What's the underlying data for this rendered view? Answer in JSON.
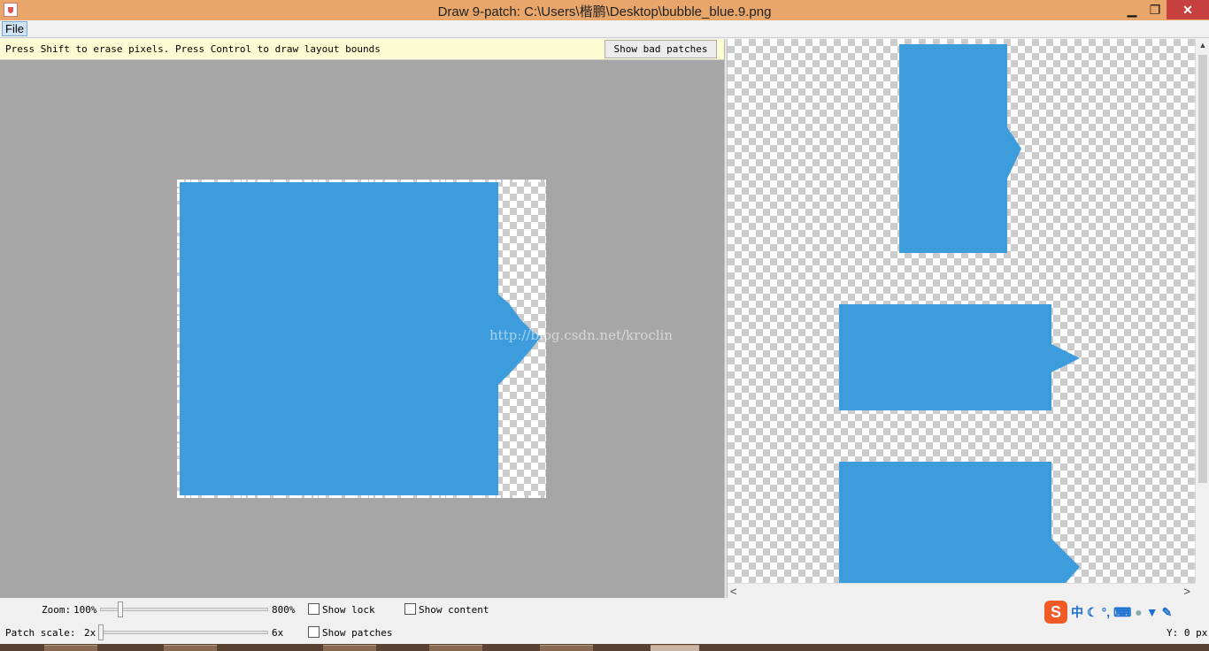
{
  "window": {
    "title": "Draw 9-patch: C:\\Users\\楷鹏\\Desktop\\bubble_blue.9.png",
    "minimize": "▁",
    "maximize": "❐",
    "close": "✕"
  },
  "menu": {
    "file": "File"
  },
  "hint": {
    "text": "Press Shift to erase pixels. Press Control to draw layout bounds",
    "show_bad_patches": "Show bad patches"
  },
  "watermark": "http://blog.csdn.net/kroclin",
  "colors": {
    "bubble": "#3d9ddc",
    "canvas_bg": "#a6a6a6",
    "titlebar": "#e8a66a"
  },
  "controls": {
    "zoom_label": "Zoom:",
    "zoom_value": "100%",
    "zoom_max": "800%",
    "zoom_level": 0.0,
    "patch_scale_label": "Patch scale:",
    "patch_scale_value": "2x",
    "patch_scale_max": "6x",
    "patch_scale_level": 0.0,
    "show_lock": "Show lock",
    "show_lock_checked": false,
    "show_content": "Show content",
    "show_content_checked": false,
    "show_patches": "Show patches",
    "show_patches_checked": false
  },
  "ime": {
    "mode": "中",
    "punct": "°,",
    "icons": [
      "sogou-icon",
      "moon-icon",
      "keyboard-icon",
      "user-icon",
      "shirt-icon",
      "wrench-icon"
    ]
  },
  "status": {
    "coordinate": "Y: 0 px"
  }
}
